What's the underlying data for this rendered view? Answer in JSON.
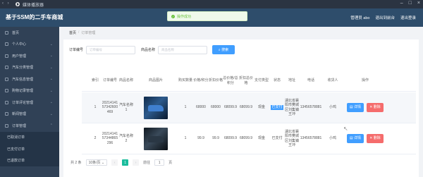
{
  "window": {
    "app_name": "媒体播放器"
  },
  "header": {
    "title": "基于SSM的二手车商城",
    "nav": [
      "管理员 abo",
      "退出到前台",
      "退出登录"
    ]
  },
  "toast": {
    "text": "操作成功"
  },
  "sidebar": {
    "items": [
      {
        "label": "首页"
      },
      {
        "label": "个人中心",
        "arrow": "⌄"
      },
      {
        "label": "用户管理",
        "arrow": "⌄"
      },
      {
        "label": "汽车分类管理",
        "arrow": "⌄"
      },
      {
        "label": "汽车信息管理",
        "arrow": "⌄"
      },
      {
        "label": "购物记录管理",
        "arrow": "⌄"
      },
      {
        "label": "订单评论管理",
        "arrow": "⌄"
      },
      {
        "label": "新闻管理",
        "arrow": "⌄"
      },
      {
        "label": "订单管理",
        "arrow": "⌃"
      }
    ],
    "subitems": [
      {
        "label": "已取消订单"
      },
      {
        "label": "已支付订单"
      },
      {
        "label": "已退款订单"
      }
    ]
  },
  "breadcrumb": {
    "home": "首页",
    "sep": "/",
    "current": "订单管理"
  },
  "search": {
    "order_label": "订单编号",
    "order_placeholder": "订单编号",
    "name_label": "商品名称",
    "name_placeholder": "商品名称",
    "button": "搜索"
  },
  "table": {
    "headers": [
      "索引",
      "订单编号",
      "商品名称",
      "商品图片",
      "购买数量",
      "价格/积分",
      "折扣价格",
      "总价格/总积分",
      "折扣总价格",
      "支付类型",
      "状态",
      "地址",
      "电话",
      "收货人",
      "操作"
    ],
    "rows": [
      {
        "index": "1",
        "order_no": "2021414157342600469",
        "name": "汽车名称1",
        "qty": "1",
        "price": "68000",
        "discount_price": "68000",
        "total": "68099.9",
        "discount_total": "68099.9",
        "pay_type": "现金",
        "status": "已支付",
        "address": "湖北省襄阳市樊城区刘集镇王冲",
        "phone": "13456578881",
        "receiver": "小鸡",
        "detail": "详情",
        "delete": "删除"
      },
      {
        "index": "2",
        "order_no": "2021414157344865296",
        "name": "汽车名称2",
        "qty": "1",
        "price": "99.9",
        "discount_price": "99.9",
        "total": "68099.9",
        "discount_total": "68099.9",
        "pay_type": "现金",
        "status": "已支付",
        "address": "湖北省襄阳市樊城区刘集镇王冲",
        "phone": "13456578881",
        "receiver": "小鸡",
        "detail": "详情",
        "delete": "删除"
      }
    ]
  },
  "pagination": {
    "total": "共 2 条",
    "size": "10条/页",
    "prev": "‹",
    "current": "1",
    "next": "›",
    "goto": "前往",
    "goto_value": "1",
    "page_unit": "页"
  }
}
